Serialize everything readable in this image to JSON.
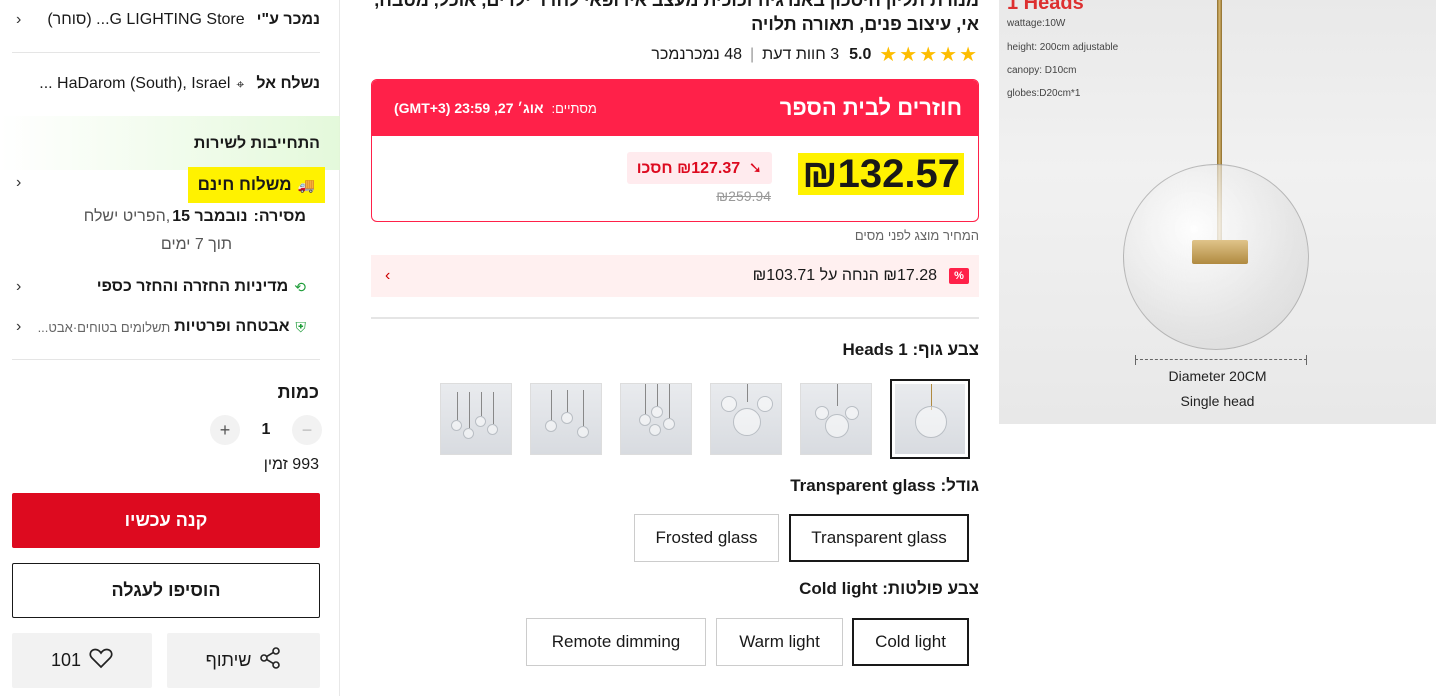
{
  "sidebar": {
    "sold_by_label": "נמכר ע\"י",
    "sold_by_value": "G LIGHTING Store...‏ (סוחר)",
    "ship_to_label": "נשלח אל",
    "ship_to_value": "HaDarom (South), Israel ...",
    "service_commitment": "התחייבות לשירות",
    "free_shipping": "משלוח חינם",
    "delivery_label": "מסירה:",
    "delivery_date": "נובמבר 15",
    "delivery_rest": ",הפריט ישלח",
    "delivery_line2": "תוך 7 ימים",
    "return_policy": "מדיניות החזרה והחזר כספי",
    "security_label": "אבטחה ופרטיות",
    "security_value": "תשלומים בטוחים·אבט...",
    "quantity_label": "כמות",
    "quantity_value": "1",
    "available": "993 זמין",
    "buy_now": "קנה עכשיו",
    "add_to_cart": "הוסיפו לעגלה",
    "share": "שיתוף",
    "wishlist_count": "101"
  },
  "product": {
    "title": "מנורת תליון חיסכון באנרגיה זכוכית מעצב אירופאי לחדר ילדים, אוכל, מטבח, אי, עיצוב פנים, תאורה תלויה",
    "rating": "5.0",
    "reviews": "3 חוות דעת",
    "sold": "48 נמכרנמכר",
    "deal_title": "חוזרים לבית הספר",
    "deal_ends_label": "מסתיים:",
    "deal_ends_value": "אוג׳ 27, 23:59 (GMT+3)",
    "price": "₪132.57",
    "save_text": "₪127.37 חסכו",
    "old_price": "₪259.94",
    "tax_note": "המחיר מוצג לפני מסים",
    "coupon_text": "₪17.28 הנחה על ₪103.71",
    "body_color_label": "צבע גוף:",
    "body_color_value": "1 Heads",
    "size_label": "גודל:",
    "size_value": "Transparent glass",
    "size_options": [
      "Transparent glass",
      "Frosted glass"
    ],
    "light_label": "צבע פולטות:",
    "light_value": "Cold light",
    "light_options": [
      "Cold light",
      "Warm light",
      "Remote dimming"
    ]
  },
  "image": {
    "heading": "1 Heads",
    "specs": [
      "wattage:10W",
      "height: 200cm adjustable",
      "canopy: D10cm",
      "globes:D20cm*1"
    ],
    "caption1": "Diameter 20CM",
    "caption2": "Single head"
  },
  "colors": {
    "accent_red": "#ff2149",
    "buy_red": "#dd0a1f",
    "highlight": "#fff200",
    "star": "#fdbd00"
  }
}
